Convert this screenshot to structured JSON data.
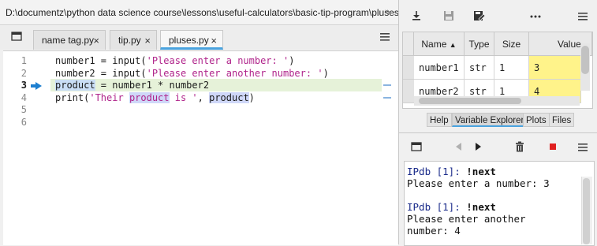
{
  "editor": {
    "path": "D:\\documentz\\python data science course\\lessons\\useful-calculators\\basic-tip-program\\pluses.py",
    "tabs": [
      {
        "label": "name tag.py",
        "close": "×"
      },
      {
        "label": "tip.py",
        "close": "×"
      },
      {
        "label": "pluses.py",
        "close": "×"
      }
    ],
    "line_numbers": [
      "1",
      "2",
      "3",
      "4",
      "5",
      "6"
    ],
    "code": {
      "l1_a": "number1 = input(",
      "l1_s": "'Please enter a number: '",
      "l1_b": ")",
      "l2_a": "number2 = input(",
      "l2_s": "'Please enter another number: '",
      "l2_b": ")",
      "l3_a": "product",
      "l3_b": " = number1 * number2",
      "l4_a": "print(",
      "l4_s": "'Their ",
      "l4_w": "product",
      "l4_s2": " is '",
      "l4_b": ", ",
      "l4_w2": "product",
      "l4_c": ")"
    }
  },
  "variable_explorer": {
    "columns": [
      "Name",
      "Type",
      "Size",
      "Value"
    ],
    "rows": [
      {
        "name": "number1",
        "type": "str",
        "size": "1",
        "value": "3"
      },
      {
        "name": "number2",
        "type": "str",
        "size": "1",
        "value": "4"
      }
    ],
    "pane_tabs": [
      "Help",
      "Variable Explorer",
      "Plots",
      "Files"
    ],
    "active_tab": "Variable Explorer"
  },
  "console": {
    "lines": [
      {
        "prompt": "IPdb [1]: ",
        "cmd": "!next"
      },
      {
        "text": "Please enter a number: 3"
      },
      {
        "text": ""
      },
      {
        "prompt": "IPdb [1]: ",
        "cmd": "!next"
      },
      {
        "text": "Please enter another"
      },
      {
        "text": "number: 4"
      }
    ]
  },
  "colors": {
    "accent": "#4aa3df",
    "current_line": "#e6f2d9",
    "value_highlight": "#fff38a",
    "string": "#b0248b",
    "stop": "#e02020"
  }
}
